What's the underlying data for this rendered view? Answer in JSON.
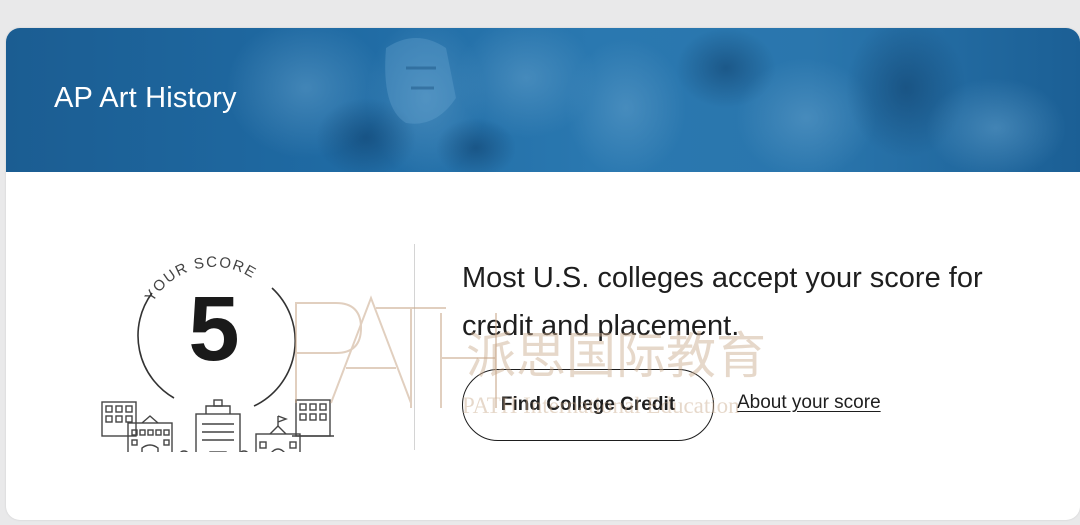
{
  "banner": {
    "title": "AP Art History",
    "color_start": "#1b5d92",
    "color_end": "#2a78b0"
  },
  "score": {
    "caption": "YOUR SCORE",
    "value": "5",
    "icon": "college-buildings-icon"
  },
  "message": {
    "text": "Most U.S. colleges accept your score for credit and placement."
  },
  "actions": {
    "find_credit_label": "Find College Credit",
    "about_score_label": "About your score"
  },
  "watermark": {
    "logo_text": "PATH",
    "chinese": "派思国际教育",
    "english": "PATH International Education",
    "color": "#c9a98b"
  }
}
